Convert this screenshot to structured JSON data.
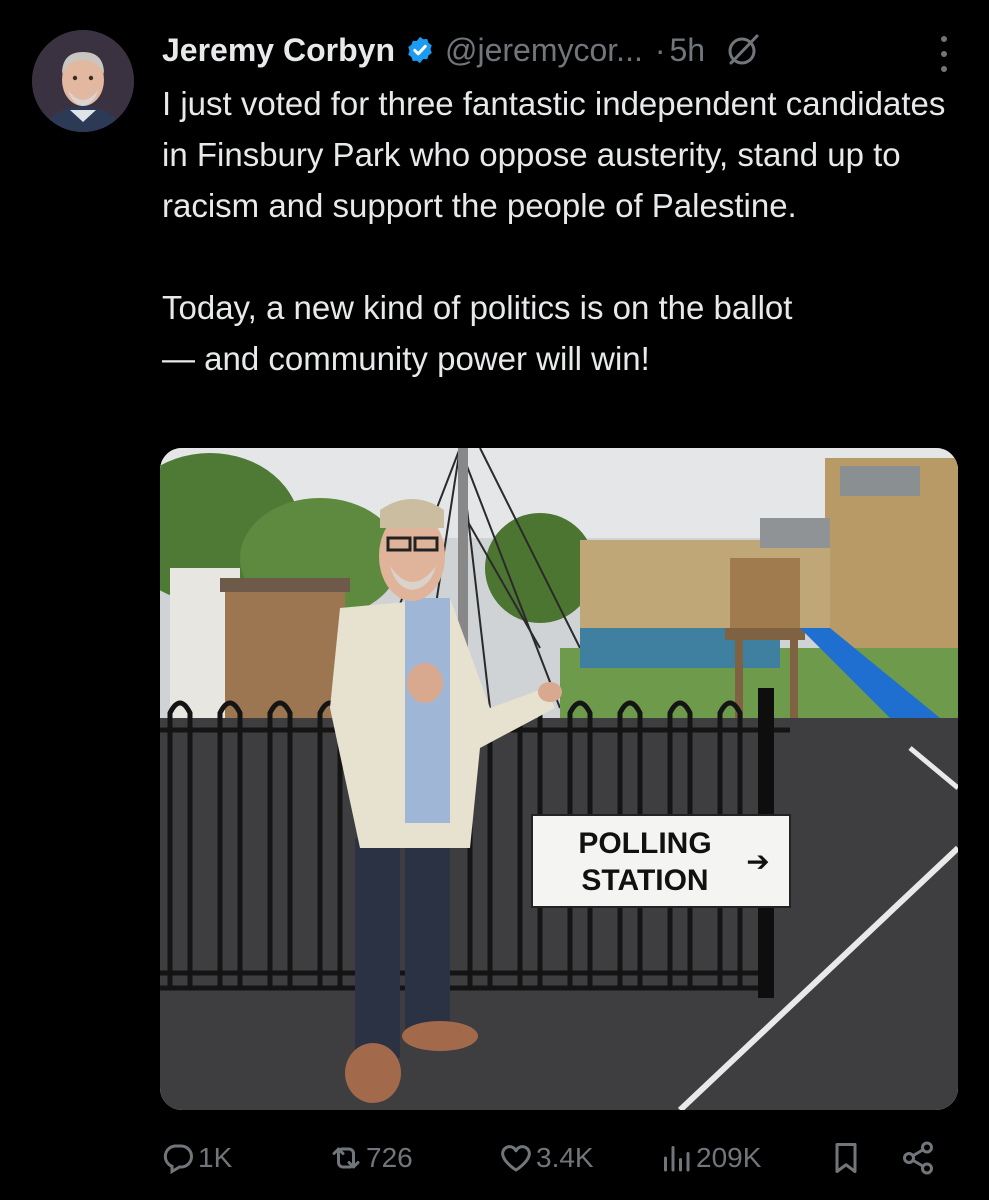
{
  "author": {
    "name": "Jeremy Corbyn",
    "handle": "@jeremycor...",
    "time_separator": "·",
    "time": "5h"
  },
  "tweet": {
    "paragraph_1": "I just voted for three fantastic independent candidates in Finsbury Park who oppose austerity, stand up to racism and support the people of Palestine.",
    "paragraph_2": "Today, a new kind of politics is on the ballot\n— and community power will win!"
  },
  "media": {
    "sign_line_1": "POLLING",
    "sign_line_2": "STATION",
    "sign_arrow": "➔"
  },
  "actions": {
    "replies": "1K",
    "reposts": "726",
    "likes": "3.4K",
    "views": "209K"
  },
  "colors": {
    "background": "#000000",
    "text": "#e7e9ea",
    "secondary": "#71767b",
    "verified": "#1d9bf0"
  }
}
